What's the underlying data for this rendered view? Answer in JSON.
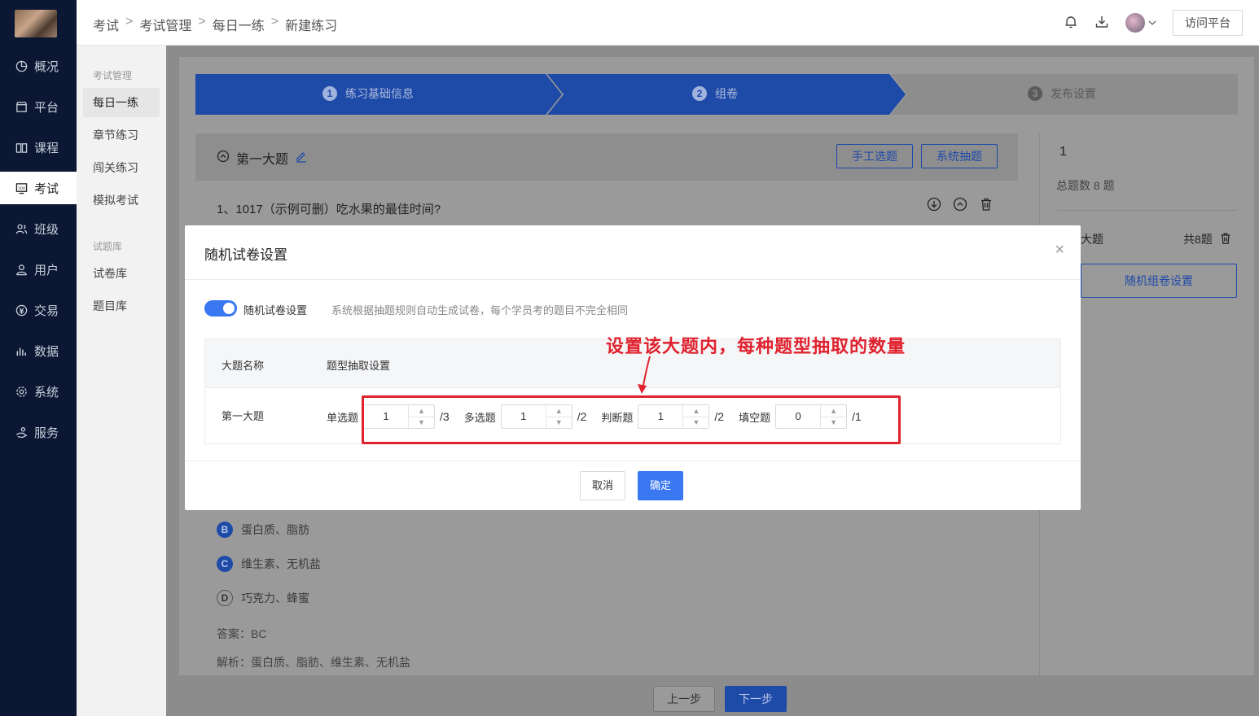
{
  "nav": {
    "items": [
      {
        "label": "概况",
        "icon": "dashboard-icon"
      },
      {
        "label": "平台",
        "icon": "store-icon"
      },
      {
        "label": "课程",
        "icon": "book-icon"
      },
      {
        "label": "考试",
        "icon": "exam-icon"
      },
      {
        "label": "班级",
        "icon": "group-icon"
      },
      {
        "label": "用户",
        "icon": "user-icon"
      },
      {
        "label": "交易",
        "icon": "transaction-icon"
      },
      {
        "label": "数据",
        "icon": "chart-icon"
      },
      {
        "label": "系统",
        "icon": "gear-icon"
      },
      {
        "label": "服务",
        "icon": "service-icon"
      }
    ],
    "active_index": 3
  },
  "subnav": {
    "group1": "考试管理",
    "group1_items": [
      "每日一练",
      "章节练习",
      "闯关练习",
      "模拟考试"
    ],
    "group2": "试题库",
    "group2_items": [
      "试卷库",
      "题目库"
    ]
  },
  "breadcrumb": [
    "考试",
    "考试管理",
    "每日一练",
    "新建练习"
  ],
  "topbar": {
    "visit_label": "访问平台"
  },
  "steps": [
    {
      "num": "1",
      "label": "练习基础信息"
    },
    {
      "num": "2",
      "label": "组卷"
    },
    {
      "num": "3",
      "label": "发布设置"
    }
  ],
  "section": {
    "title": "第一大题",
    "manual_btn": "手工选题",
    "system_btn": "系统抽题"
  },
  "question": {
    "text": "1、1017（示例可删）吃水果的最佳时间?",
    "options": [
      {
        "key": "B",
        "text": "蛋白质、脂肪",
        "selected": true
      },
      {
        "key": "C",
        "text": "维生素、无机盐",
        "selected": true
      },
      {
        "key": "D",
        "text": "巧克力、蜂蜜",
        "selected": false
      }
    ],
    "answer": "答案：BC",
    "analysis": "解析：蛋白质、脂肪、维生素、无机盐"
  },
  "right_panel": {
    "number": "1",
    "total": "总题数 8 题",
    "section_name": "大题",
    "section_count": "共8题",
    "random_btn": "随机组卷设置"
  },
  "footer": {
    "prev": "上一步",
    "next": "下一步"
  },
  "modal": {
    "title": "随机试卷设置",
    "toggle_label": "随机试卷设置",
    "toggle_on": true,
    "toggle_desc": "系统根据抽题规则自动生成试卷，每个学员考的题目不完全相同",
    "table": {
      "col_name": "大题名称",
      "col_rule": "题型抽取设置",
      "row_name": "第一大题",
      "rules": [
        {
          "label": "单选题",
          "value": "1",
          "max": "/3"
        },
        {
          "label": "多选题",
          "value": "1",
          "max": "/2"
        },
        {
          "label": "判断题",
          "value": "1",
          "max": "/2"
        },
        {
          "label": "填空题",
          "value": "0",
          "max": "/1"
        }
      ]
    },
    "cancel": "取消",
    "ok": "确定"
  },
  "annotation": "设置该大题内，每种题型抽取的数量",
  "colors": {
    "primary": "#3a78f2",
    "nav_bg": "#0b1733",
    "annotation": "#e0222e",
    "step_active": "#1e4aa8"
  }
}
